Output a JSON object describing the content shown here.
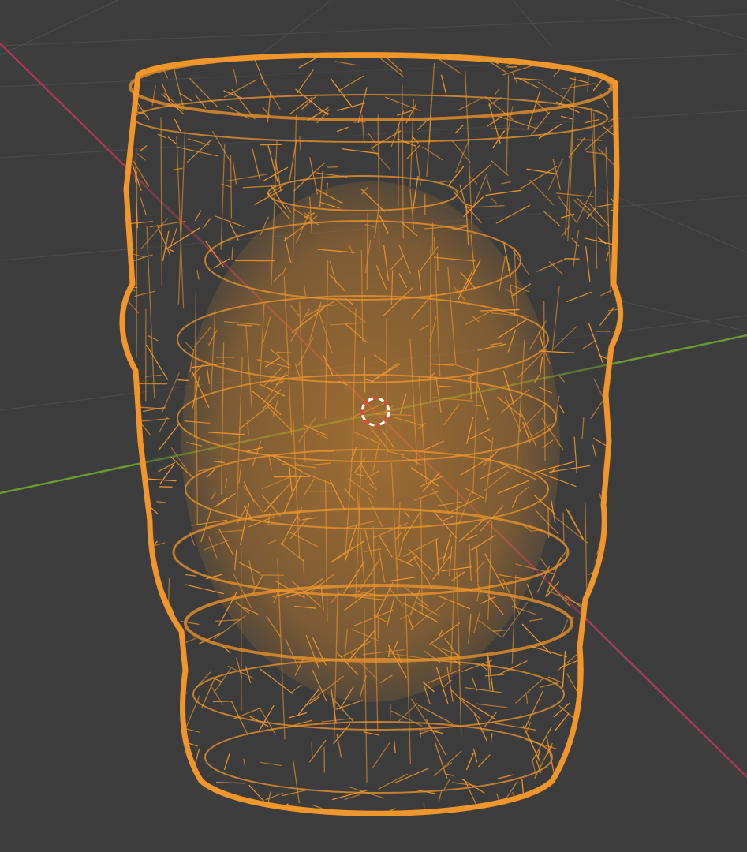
{
  "viewport": {
    "mode": "wireframe",
    "background_color": "#3d3d3d",
    "grid_color": "#4b4b4b",
    "x_axis_color": "#a63a52",
    "y_axis_color": "#6b9a2f",
    "selection_color": "#f0962a"
  },
  "selected_object": {
    "shape": "cylinder-mesh",
    "display": "wireframe",
    "selected": true
  },
  "cursor": {
    "icon": "3d-cursor-icon",
    "ring_color_a": "#ffffff",
    "ring_color_b": "#e04a3a"
  }
}
